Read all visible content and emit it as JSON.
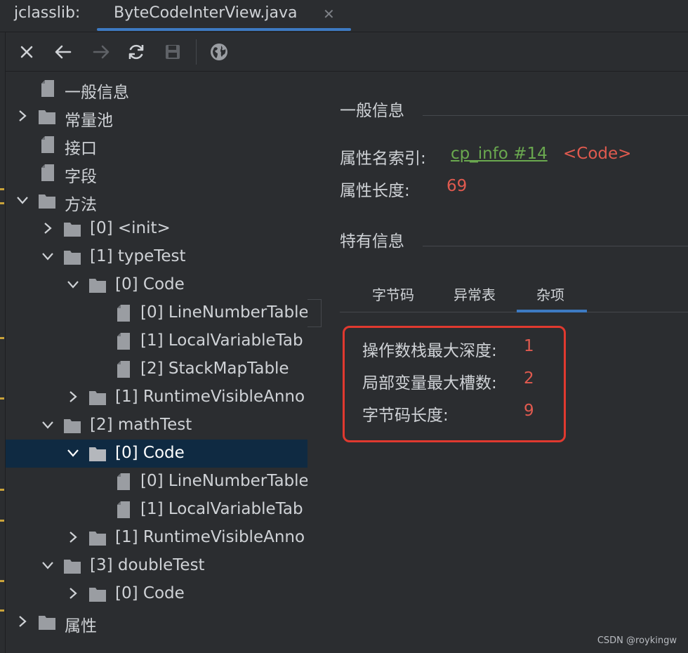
{
  "tabs": {
    "prefix": "jclasslib:",
    "active": "ByteCodeInterView.java",
    "close": "✕"
  },
  "toolbar": {
    "icons": [
      "close-icon",
      "back-icon",
      "forward-icon",
      "refresh-icon",
      "save-icon",
      "browser-icon"
    ]
  },
  "tree": {
    "general": "一般信息",
    "constant_pool": "常量池",
    "interfaces": "接口",
    "fields": "字段",
    "methods": "方法",
    "m0": "[0] <init>",
    "m1": "[1] typeTest",
    "m1_code": "[0] Code",
    "m1_code_a0": "[0] LineNumberTable",
    "m1_code_a1": "[1] LocalVariableTab",
    "m1_code_a2": "[2] StackMapTable",
    "m1_rva": "[1] RuntimeVisibleAnno",
    "m2": "[2] mathTest",
    "m2_code": "[0] Code",
    "m2_code_a0": "[0] LineNumberTable",
    "m2_code_a1": "[1] LocalVariableTab",
    "m2_rva": "[1] RuntimeVisibleAnno",
    "m3": "[3] doubleTest",
    "m3_code": "[0] Code",
    "attributes": "属性"
  },
  "detail": {
    "general_title": "一般信息",
    "attr_name_index_label": "属性名索引:",
    "attr_name_index_link": "cp_info #14",
    "attr_name_index_value": "<Code>",
    "attr_length_label": "属性长度:",
    "attr_length_value": "69",
    "specific_title": "特有信息",
    "subtabs": [
      "字节码",
      "异常表",
      "杂项"
    ],
    "max_stack_label": "操作数栈最大深度:",
    "max_stack_value": "1",
    "max_locals_label": "局部变量最大槽数:",
    "max_locals_value": "2",
    "code_length_label": "字节码长度:",
    "code_length_value": "9"
  },
  "watermark": "CSDN @roykingw",
  "colors": {
    "background": "#2b2d30",
    "selection": "#0f2a42",
    "accent": "#3d7ac2",
    "link": "#6aa84f",
    "value_red": "#e05a4f",
    "highlight_box": "#e0392f"
  }
}
